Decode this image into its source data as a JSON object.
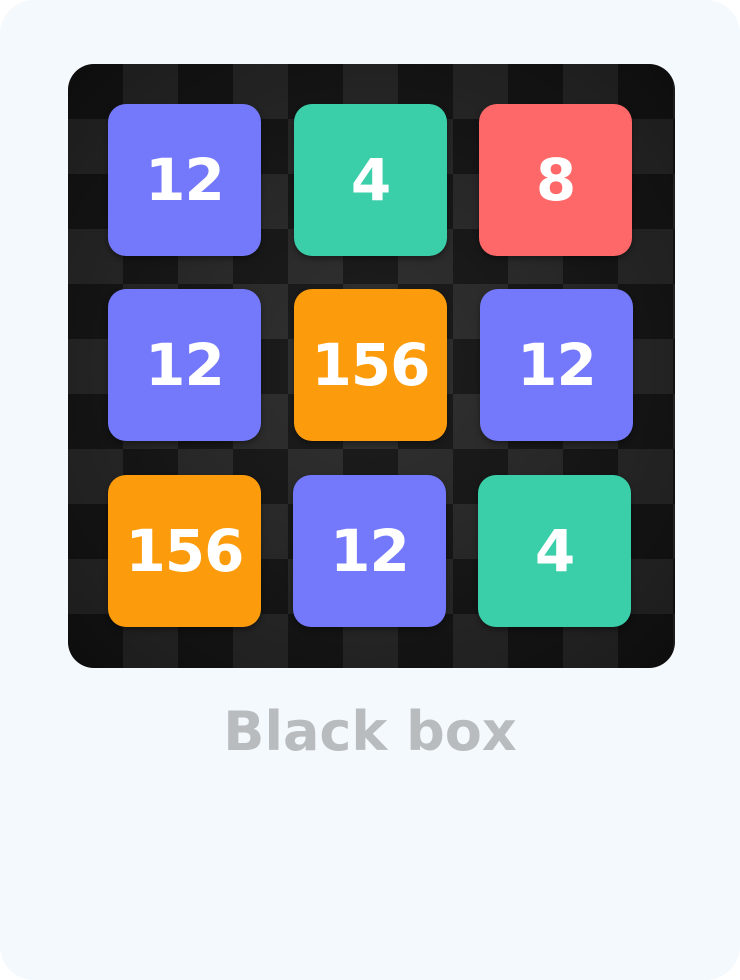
{
  "board": {
    "tiles": [
      {
        "value": "12",
        "color": "#7479fb"
      },
      {
        "value": "4",
        "color": "#3acea9"
      },
      {
        "value": "8",
        "color": "#fe6868"
      },
      {
        "value": "12",
        "color": "#7479fb"
      },
      {
        "value": "156",
        "color": "#fc9b0c"
      },
      {
        "value": "12",
        "color": "#7479fb"
      },
      {
        "value": "156",
        "color": "#fc9b0c"
      },
      {
        "value": "12",
        "color": "#7479fb"
      },
      {
        "value": "4",
        "color": "#3acea9"
      }
    ],
    "background_theme": "black checkerboard"
  },
  "caption": "Black box",
  "colors": {
    "card_background": "#f4f9fe",
    "caption_text": "#b9bcbf",
    "tile_text": "#ffffff"
  }
}
